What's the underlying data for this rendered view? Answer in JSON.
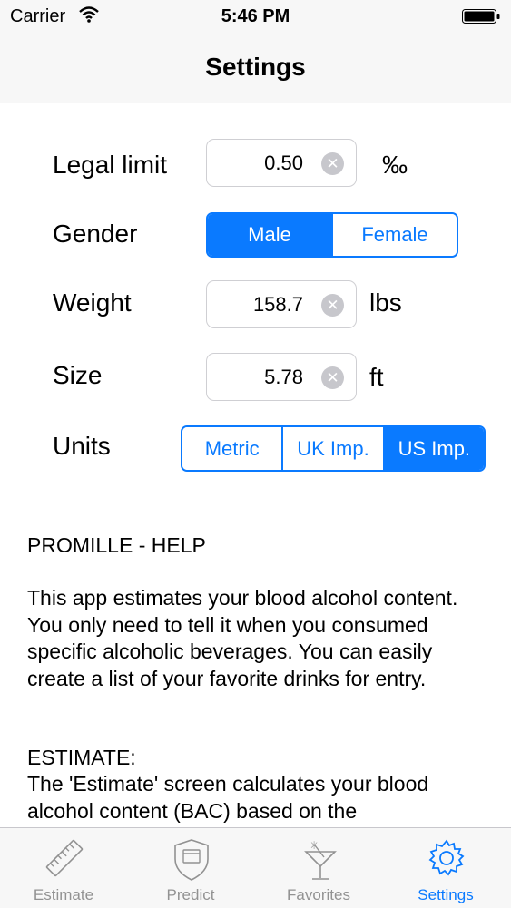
{
  "status_bar": {
    "carrier": "Carrier",
    "time": "5:46 PM",
    "wifi_icon": "wifi-icon",
    "battery_icon": "battery-icon"
  },
  "nav": {
    "title": "Settings"
  },
  "form": {
    "legal_limit": {
      "label": "Legal limit",
      "value": "0.50",
      "unit": "‰"
    },
    "gender": {
      "label": "Gender",
      "options": [
        "Male",
        "Female"
      ],
      "selected": "Male"
    },
    "weight": {
      "label": "Weight",
      "value": "158.7",
      "unit": "lbs"
    },
    "size": {
      "label": "Size",
      "value": "5.78",
      "unit": "ft"
    },
    "units": {
      "label": "Units",
      "options": [
        "Metric",
        "UK Imp.",
        "US Imp."
      ],
      "selected": "US Imp."
    }
  },
  "help": {
    "title": "PROMILLE - HELP",
    "intro": "This app estimates your blood alcohol content. You only need to tell it when you consumed specific alcoholic beverages. You can easily create a list of your favorite drinks for entry.",
    "estimate_heading": "ESTIMATE:",
    "estimate_text": "The 'Estimate' screen calculates your blood alcohol content (BAC) based on the"
  },
  "tabs": [
    {
      "label": "Estimate",
      "icon": "ruler-icon",
      "active": false
    },
    {
      "label": "Predict",
      "icon": "shield-icon",
      "active": false
    },
    {
      "label": "Favorites",
      "icon": "cocktail-icon",
      "active": false
    },
    {
      "label": "Settings",
      "icon": "gear-icon",
      "active": true
    }
  ],
  "colors": {
    "accent": "#0a7aff",
    "inactive": "#929292",
    "bar_bg": "#f7f7f7"
  }
}
